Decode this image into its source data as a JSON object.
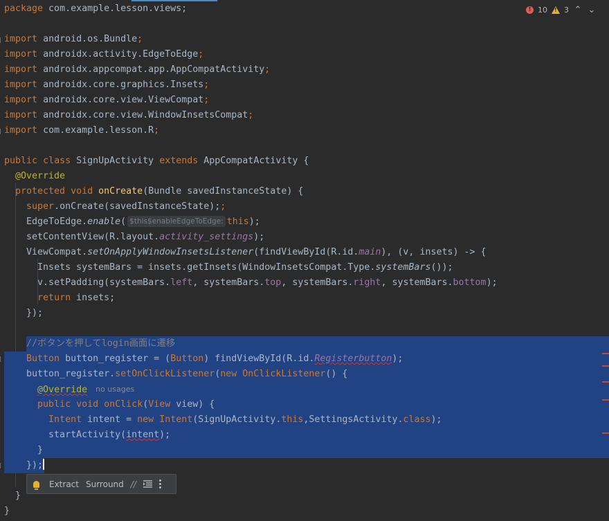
{
  "inspections": {
    "errors": "10",
    "warnings": "3"
  },
  "lines": {
    "l1": [
      "package",
      " com.example.lesson.views;"
    ],
    "imports": [
      "android.os.Bundle",
      "androidx.activity.EdgeToEdge",
      "androidx.appcompat.app.AppCompatActivity",
      "androidx.core.graphics.Insets",
      "androidx.core.view.ViewCompat",
      "androidx.core.view.WindowInsetsCompat",
      "com.example.lesson.R"
    ],
    "import_kw": "import",
    "class_decl": {
      "public": "public",
      "class": "class",
      "name": "SignUpActivity",
      "extends": "extends",
      "parent": "AppCompatActivity {"
    },
    "override": "@Override",
    "oncreate": {
      "protected": "protected",
      "void": "void",
      "name": "onCreate",
      "params": "(Bundle savedInstanceState) {"
    },
    "super": {
      "kw": "super",
      "rest": ".onCreate(savedInstanceState);"
    },
    "edge": {
      "a": "EdgeToEdge.",
      "b": "enable",
      "c": "(",
      "hint": "$this$enableEdgeToEdge:",
      "d": "this",
      "e": ");"
    },
    "content": {
      "a": "setContentView(R.layout.",
      "b": "activity_settings",
      "c": ");"
    },
    "vc": {
      "a": "ViewCompat.",
      "b": "setOnApplyWindowInsetsListener",
      "c": "(findViewById(R.id.",
      "d": "main",
      "e": "), (v, insets) -> {"
    },
    "insets": {
      "a": "Insets systemBars = insets.getInsets(WindowInsetsCompat.Type.",
      "b": "systemBars",
      "c": "());"
    },
    "pad": {
      "a": "v.setPadding(systemBars.",
      "b": "left",
      "c": ", systemBars.",
      "d": "top",
      "e": ", systemBars.",
      "f": "right",
      "g": ", systemBars.",
      "h": "bottom",
      "i": ");"
    },
    "ret": {
      "kw": "return",
      "rest": " insets;"
    },
    "close1": "});",
    "comment": "//ボタンを押してlogin画面に遷移",
    "btn": {
      "a": "Button",
      "b": " button_register = (",
      "c": "Button",
      "d": ") findViewById(R.id.",
      "e": "Registerbutton",
      "f": ");"
    },
    "listener": {
      "a": "button_register.",
      "b": "setOnClickListener",
      "c": "(",
      "d": "new",
      "e": " ",
      "f": "OnClickListener",
      "g": "() {"
    },
    "override2": "@Override",
    "no_usages": "no usages",
    "onclick": {
      "a": "public",
      "b": " ",
      "c": "void",
      "d": " ",
      "e": "onClick",
      "f": "(",
      "g": "View",
      "h": " view) {"
    },
    "intent": {
      "a": "Intent",
      "b": " intent = ",
      "c": "new",
      "d": " ",
      "e": "Intent",
      "f": "(SignUpActivity.",
      "g": "this",
      "h": ",SettingsActivity.",
      "i": "class",
      "j": ");"
    },
    "start": {
      "a": "startActivity(",
      "b": "intent",
      "c": ");"
    },
    "brace_inner": "}",
    "close2": "});",
    "brace_method": "}",
    "brace_class": "}"
  },
  "toolbar": {
    "extract": "Extract",
    "surround": "Surround"
  }
}
